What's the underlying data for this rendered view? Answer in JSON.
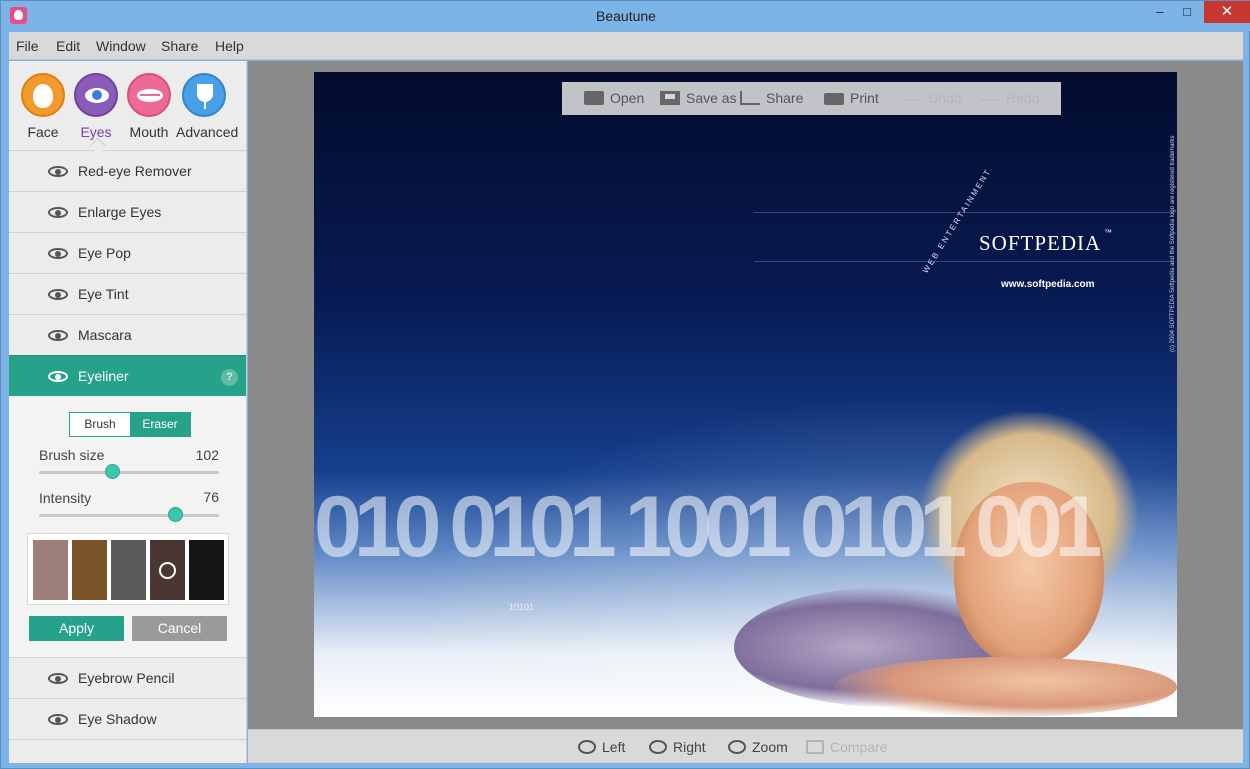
{
  "window": {
    "title": "Beautune",
    "minimize": "–",
    "maximize": "□",
    "close": "✕"
  },
  "menu": [
    "File",
    "Edit",
    "Window",
    "Share",
    "Help"
  ],
  "categories": [
    {
      "label": "Face",
      "icon": "face-icon",
      "color": "#f39a2c"
    },
    {
      "label": "Eyes",
      "icon": "eye-icon",
      "color": "#8b5bb8",
      "active": true
    },
    {
      "label": "Mouth",
      "icon": "lips-icon",
      "color": "#ec6a95"
    },
    {
      "label": "Advanced",
      "icon": "tulip-icon",
      "color": "#4aa0e6"
    }
  ],
  "tools": [
    {
      "label": "Red-eye Remover",
      "icon": "red-eye-remover-icon"
    },
    {
      "label": "Enlarge Eyes",
      "icon": "enlarge-eyes-icon"
    },
    {
      "label": "Eye Pop",
      "icon": "eye-pop-icon"
    },
    {
      "label": "Eye Tint",
      "icon": "eye-tint-icon"
    },
    {
      "label": "Mascara",
      "icon": "mascara-icon"
    },
    {
      "label": "Eyeliner",
      "icon": "eyeliner-icon",
      "active": true
    },
    {
      "label": "Eyebrow Pencil",
      "icon": "eyebrow-pencil-icon"
    },
    {
      "label": "Eye Shadow",
      "icon": "eye-shadow-icon"
    }
  ],
  "eyeliner_panel": {
    "help": "?",
    "mode_brush": "Brush",
    "mode_eraser": "Eraser",
    "brush_size_label": "Brush size",
    "brush_size_value": "102",
    "brush_size_fraction": 0.41,
    "intensity_label": "Intensity",
    "intensity_value": "76",
    "intensity_fraction": 0.76,
    "swatches": [
      "#9e7f79",
      "#7a5228",
      "#5b5b5b",
      "#4a3733",
      "#161616"
    ],
    "selected_swatch": 3,
    "apply": "Apply",
    "cancel": "Cancel"
  },
  "toolbar": {
    "open": "Open",
    "save_as": "Save as",
    "share": "Share",
    "print": "Print",
    "undo": "Undo",
    "redo": "Redo"
  },
  "canvas": {
    "brand": "SOFTPEDIA",
    "tm": "™",
    "url": "www.softpedia.com",
    "arc_text": "WEB ENTERTAINMENT",
    "side_text": "(c) 2004 SOFTPEDIA  Softpedia and the Softpedia logo are registered trademarks",
    "digits": "010 0101 1001 0101 001",
    "digits_small": "10101"
  },
  "bottom": {
    "left": "Left",
    "right": "Right",
    "zoom": "Zoom",
    "compare": "Compare"
  },
  "colors": {
    "accent": "#26a28a",
    "titlebar": "#7cb4e8",
    "close": "#c7372f"
  }
}
